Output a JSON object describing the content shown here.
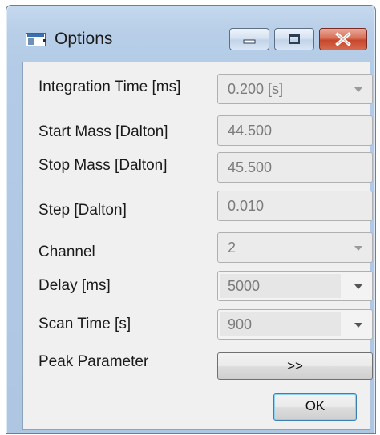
{
  "window": {
    "title": "Options"
  },
  "fields": [
    {
      "label": "Integration Time [ms]",
      "value": "0.200 [s]",
      "type": "dropdown"
    },
    {
      "label": "Start Mass [Dalton]",
      "value": "44.500",
      "type": "text"
    },
    {
      "label": "Stop Mass [Dalton]",
      "value": "45.500",
      "type": "text"
    },
    {
      "label": "Step [Dalton]",
      "value": "0.010",
      "type": "text"
    },
    {
      "label": "Channel",
      "value": "2",
      "type": "dropdown"
    },
    {
      "label": "Delay [ms]",
      "value": "5000",
      "type": "editable-combo"
    },
    {
      "label": "Scan Time [s]",
      "value": "900",
      "type": "editable-combo"
    }
  ],
  "peak": {
    "label": "Peak Parameter",
    "button_label": ">>"
  },
  "buttons": {
    "ok_label": "OK"
  },
  "icons": {
    "app": "window-app-icon",
    "minimize": "minimize-icon",
    "maximize": "maximize-icon",
    "close": "close-icon"
  }
}
